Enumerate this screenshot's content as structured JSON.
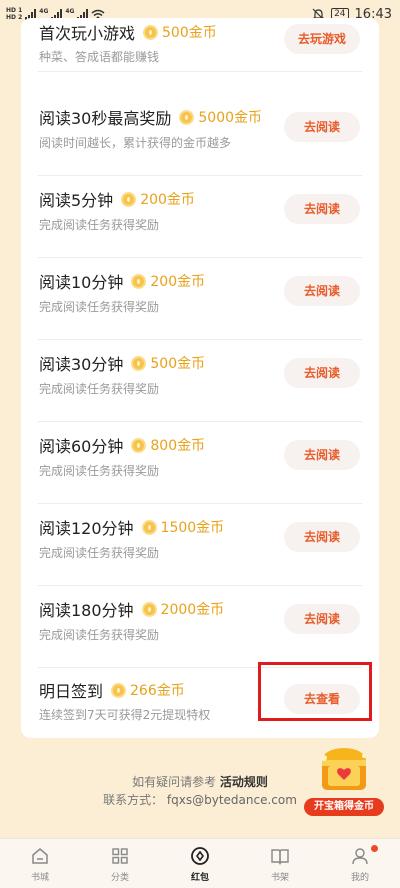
{
  "status_bar": {
    "sim1": "HD 1",
    "sim2": "HD 2",
    "net": "4G",
    "battery": "24",
    "time": "16:43"
  },
  "tasks": [
    {
      "title": "首次玩小游戏",
      "reward": "500金币",
      "desc": "种菜、答成语都能赚钱",
      "button": "去玩游戏"
    },
    {
      "title": "阅读30秒最高奖励",
      "reward": "5000金币",
      "desc": "阅读时间越长，累计获得的金币越多",
      "button": "去阅读"
    },
    {
      "title": "阅读5分钟",
      "reward": "200金币",
      "desc": "完成阅读任务获得奖励",
      "button": "去阅读"
    },
    {
      "title": "阅读10分钟",
      "reward": "200金币",
      "desc": "完成阅读任务获得奖励",
      "button": "去阅读"
    },
    {
      "title": "阅读30分钟",
      "reward": "500金币",
      "desc": "完成阅读任务获得奖励",
      "button": "去阅读"
    },
    {
      "title": "阅读60分钟",
      "reward": "800金币",
      "desc": "完成阅读任务获得奖励",
      "button": "去阅读"
    },
    {
      "title": "阅读120分钟",
      "reward": "1500金币",
      "desc": "完成阅读任务获得奖励",
      "button": "去阅读"
    },
    {
      "title": "阅读180分钟",
      "reward": "2000金币",
      "desc": "完成阅读任务获得奖励",
      "button": "去阅读"
    },
    {
      "title": "明日签到",
      "reward": "266金币",
      "desc": "连续签到7天可获得2元提现特权",
      "button": "去查看"
    }
  ],
  "footer": {
    "question_prefix": "如有疑问请参考",
    "rules_link": "活动规则",
    "contact_prefix": "联系方式：",
    "email": "fqxs@bytedance.com"
  },
  "chest": {
    "label": "开宝箱得金币"
  },
  "nav": [
    {
      "label": "书城",
      "icon": "home-icon"
    },
    {
      "label": "分类",
      "icon": "grid-icon"
    },
    {
      "label": "红包",
      "icon": "coin-icon"
    },
    {
      "label": "书架",
      "icon": "book-icon"
    },
    {
      "label": "我的",
      "icon": "user-icon"
    }
  ],
  "colors": {
    "background": "#fbeed5",
    "reward": "#e8a21b",
    "button_text": "#e85b2a",
    "highlight": "#e01b1b"
  }
}
